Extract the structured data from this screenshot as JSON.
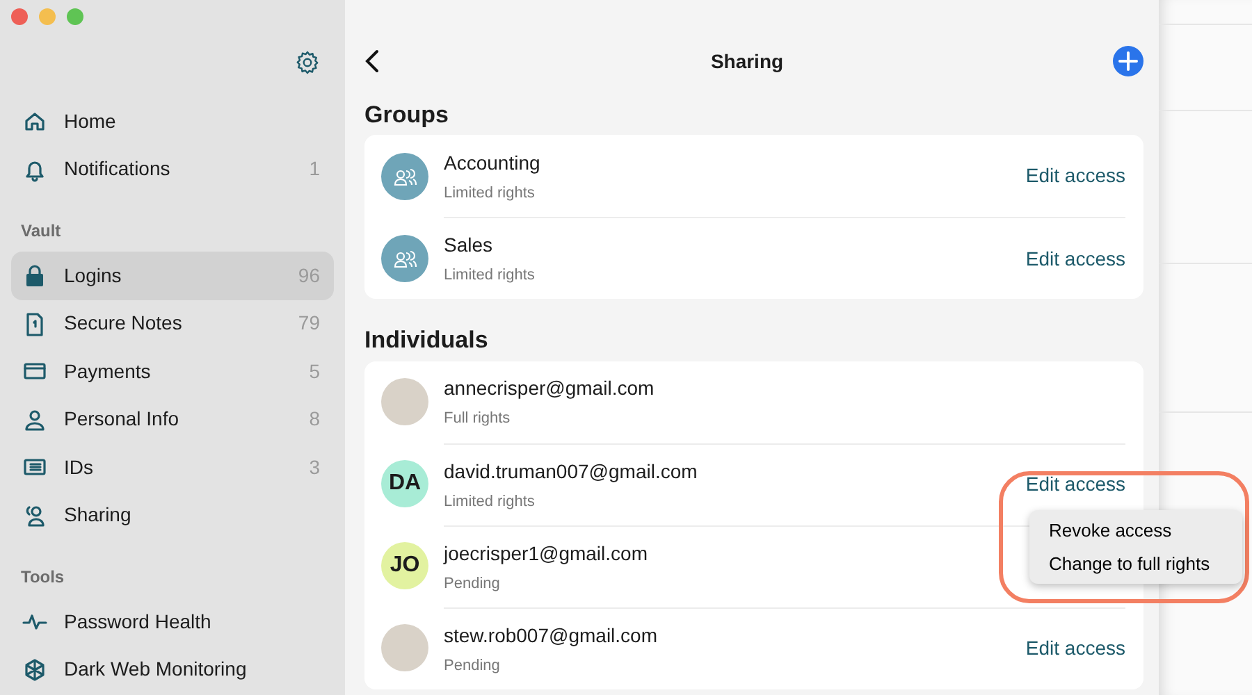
{
  "sidebar": {
    "top_items": [
      {
        "kind": "home",
        "label": "Home",
        "selected": false
      },
      {
        "kind": "bell",
        "label": "Notifications",
        "count": "1",
        "selected": false
      }
    ],
    "sections": [
      {
        "title": "Vault",
        "items": [
          {
            "kind": "lock",
            "label": "Logins",
            "count": "96",
            "selected": true
          },
          {
            "kind": "note",
            "label": "Secure Notes",
            "count": "79",
            "selected": false
          },
          {
            "kind": "card",
            "label": "Payments",
            "count": "5",
            "selected": false
          },
          {
            "kind": "person",
            "label": "Personal Info",
            "count": "8",
            "selected": false
          },
          {
            "kind": "id",
            "label": "IDs",
            "count": "3",
            "selected": false
          },
          {
            "kind": "share",
            "label": "Sharing",
            "selected": false
          }
        ]
      },
      {
        "title": "Tools",
        "items": [
          {
            "kind": "pulse",
            "label": "Password Health",
            "selected": false
          },
          {
            "kind": "web",
            "label": "Dark Web Monitoring",
            "selected": false
          }
        ]
      }
    ]
  },
  "header": {
    "title": "Sharing"
  },
  "groups": {
    "title": "Groups",
    "rows": [
      {
        "name": "Accounting",
        "rights": "Limited rights",
        "action": "Edit access"
      },
      {
        "name": "Sales",
        "rights": "Limited rights",
        "action": "Edit access"
      }
    ]
  },
  "individuals": {
    "title": "Individuals",
    "rows": [
      {
        "kind": "photo",
        "email": "annecrisper@gmail.com",
        "rights": "Full rights"
      },
      {
        "kind": "initials",
        "initials": "DA",
        "color": "#a8ecd6",
        "email": "david.truman007@gmail.com",
        "rights": "Limited rights",
        "action": "Edit access"
      },
      {
        "kind": "initials",
        "initials": "JO",
        "color": "#e2f2a0",
        "email": "joecrisper1@gmail.com",
        "rights": "Pending"
      },
      {
        "kind": "photo",
        "email": "stew.rob007@gmail.com",
        "rights": "Pending",
        "action": "Edit access"
      }
    ]
  },
  "popup_menu": {
    "highlighted": true,
    "items": [
      "Revoke access",
      "Change to full rights"
    ]
  }
}
